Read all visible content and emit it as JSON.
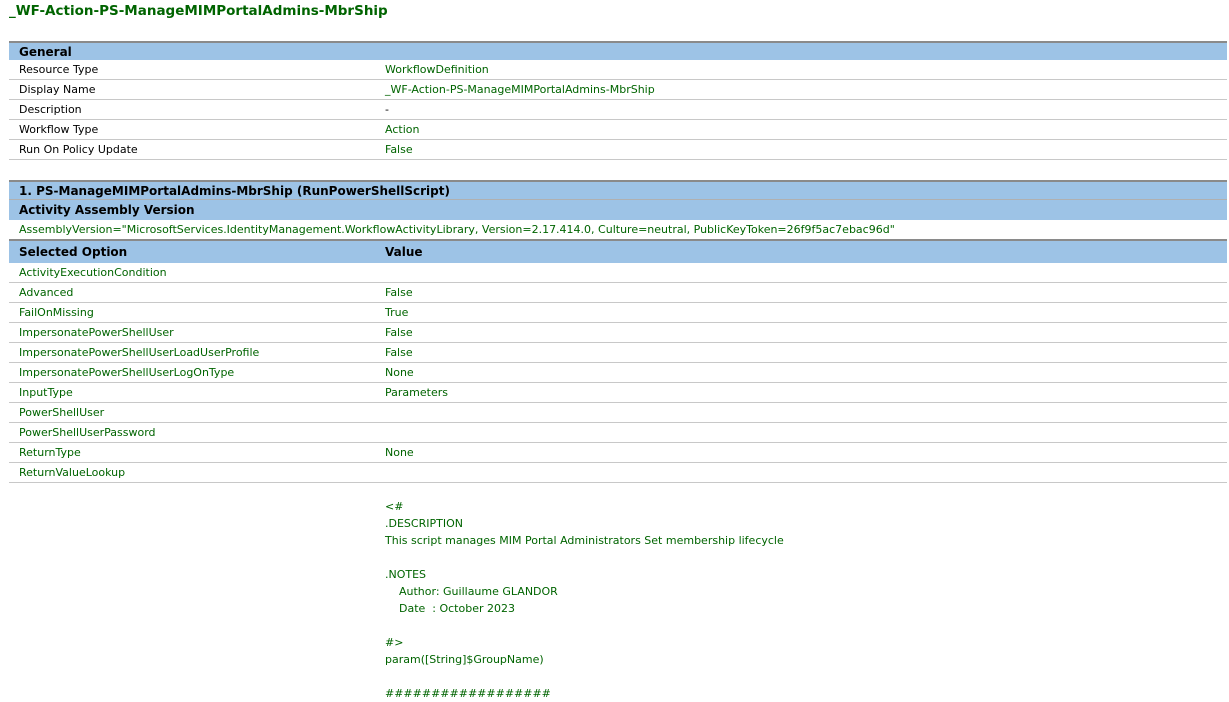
{
  "title": "_WF-Action-PS-ManageMIMPortalAdmins-MbrShip",
  "general": {
    "header": "General",
    "rows": [
      {
        "label": "Resource Type",
        "value": "WorkflowDefinition"
      },
      {
        "label": "Display Name",
        "value": "_WF-Action-PS-ManageMIMPortalAdmins-MbrShip"
      },
      {
        "label": "Description",
        "value": "-"
      },
      {
        "label": "Workflow Type",
        "value": "Action"
      },
      {
        "label": "Run On Policy Update",
        "value": "False"
      }
    ]
  },
  "activity": {
    "header": "1. PS-ManageMIMPortalAdmins-MbrShip (RunPowerShellScript)",
    "assembly_header": "Activity Assembly Version",
    "assembly_value": "AssemblyVersion=\"MicrosoftServices.IdentityManagement.WorkflowActivityLibrary, Version=2.17.414.0, Culture=neutral, PublicKeyToken=26f9f5ac7ebac96d\"",
    "col_option": "Selected Option",
    "col_value": "Value",
    "options": [
      {
        "label": "ActivityExecutionCondition",
        "value": ""
      },
      {
        "label": "Advanced",
        "value": "False"
      },
      {
        "label": "FailOnMissing",
        "value": "True"
      },
      {
        "label": "ImpersonatePowerShellUser",
        "value": "False"
      },
      {
        "label": "ImpersonatePowerShellUserLoadUserProfile",
        "value": "False"
      },
      {
        "label": "ImpersonatePowerShellUserLogOnType",
        "value": "None"
      },
      {
        "label": "InputType",
        "value": "Parameters"
      },
      {
        "label": "PowerShellUser",
        "value": ""
      },
      {
        "label": "PowerShellUserPassword",
        "value": ""
      },
      {
        "label": "ReturnType",
        "value": "None"
      },
      {
        "label": "ReturnValueLookup",
        "value": ""
      }
    ],
    "script": "<#\n.DESCRIPTION\nThis script manages MIM Portal Administrators Set membership lifecycle\n\n.NOTES\n    Author: Guillaume GLANDOR\n    Date  : October 2023\n\n#>\nparam([String]$GroupName)\n\n##################"
  }
}
